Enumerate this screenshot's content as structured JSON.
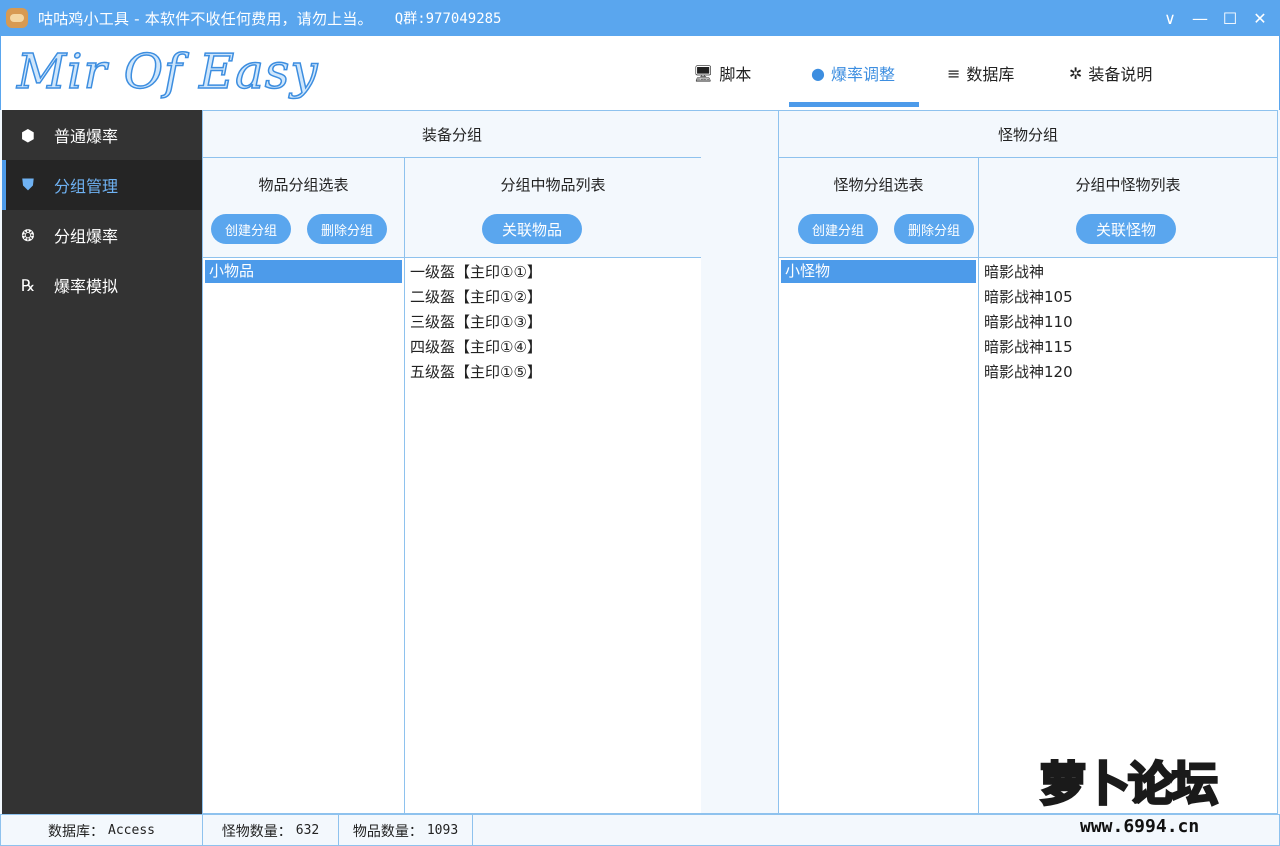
{
  "window": {
    "title": "咕咕鸡小工具 - 本软件不收任何费用，请勿上当。",
    "qq": "Q群:977049285",
    "controls": {
      "dropdown": "∨",
      "minimize": "—",
      "maximize": "☐",
      "close": "✕"
    }
  },
  "header": {
    "logo": "Mir Of Easy",
    "tabs": [
      {
        "label": "脚本",
        "icon": "🖥"
      },
      {
        "label": "爆率调整",
        "icon": "●"
      },
      {
        "label": "数据库",
        "icon": "≡"
      },
      {
        "label": "装备说明",
        "icon": "✲"
      }
    ],
    "active_tab": 1
  },
  "sidebar": {
    "items": [
      {
        "label": "普通爆率",
        "icon": "⬢"
      },
      {
        "label": "分组管理",
        "icon": "⛊"
      },
      {
        "label": "分组爆率",
        "icon": "❂"
      },
      {
        "label": "爆率模拟",
        "icon": "℞"
      }
    ],
    "active": 1
  },
  "equipment": {
    "title": "装备分组",
    "group_list_title": "物品分组选表",
    "create_btn": "创建分组",
    "delete_btn": "删除分组",
    "items_title": "分组中物品列表",
    "link_btn": "关联物品",
    "groups": [
      "小物品"
    ],
    "items": [
      "一级盔【主印①①】",
      "二级盔【主印①②】",
      "三级盔【主印①③】",
      "四级盔【主印①④】",
      "五级盔【主印①⑤】"
    ]
  },
  "monster": {
    "title": "怪物分组",
    "group_list_title": "怪物分组选表",
    "create_btn": "创建分组",
    "delete_btn": "删除分组",
    "items_title": "分组中怪物列表",
    "link_btn": "关联怪物",
    "groups": [
      "小怪物"
    ],
    "items": [
      "暗影战神",
      "暗影战神105",
      "暗影战神110",
      "暗影战神115",
      "暗影战神120"
    ]
  },
  "status": {
    "db_label": "数据库：",
    "db_value": "Access",
    "monster_label": "怪物数量：",
    "monster_value": "632",
    "item_label": "物品数量：",
    "item_value": "1093"
  },
  "watermark": {
    "text": "萝卜论坛",
    "url": "www.6994.cn"
  }
}
